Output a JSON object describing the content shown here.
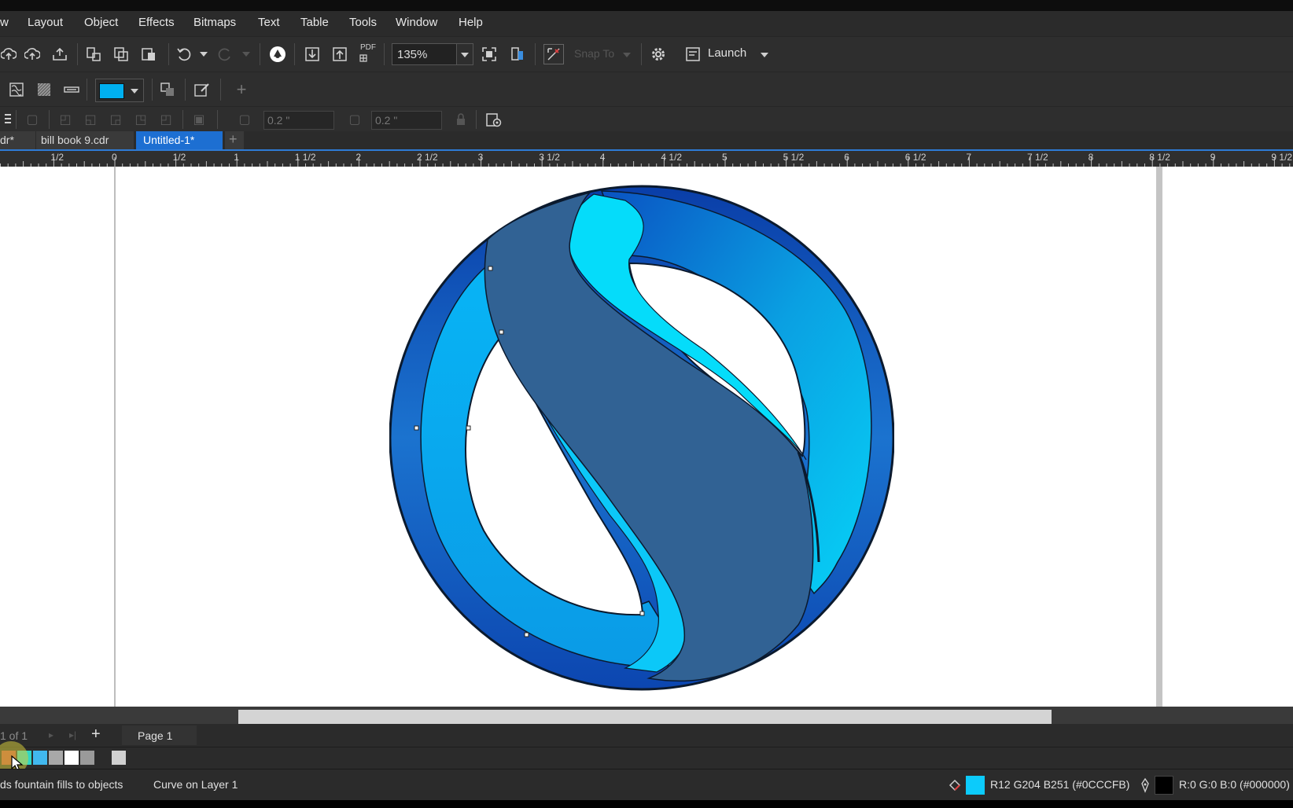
{
  "menu": {
    "items": [
      "w",
      "Layout",
      "Object",
      "Effects",
      "Bitmaps",
      "Text",
      "Table",
      "Tools",
      "Window",
      "Help"
    ]
  },
  "toolbar": {
    "zoom_level": "135%",
    "pdf_label": "PDF",
    "snap_to_label": "Snap To",
    "launch_label": "Launch",
    "fill_color": "#00b0f0"
  },
  "property_bar": {
    "outline_width_1": "0.2 \"",
    "outline_width_2": "0.2 \""
  },
  "document_tabs": {
    "tab1": "dr*",
    "tab2": "bill book 9.cdr",
    "tab3": "Untitled-1*",
    "add": "+"
  },
  "ruler": {
    "labels": [
      "1/2",
      "0",
      "1/2",
      "1",
      "1 1/2",
      "2",
      "2 1/2",
      "3",
      "3 1/2",
      "4",
      "4 1/2",
      "5",
      "5 1/2",
      "6",
      "6 1/2",
      "7",
      "7 1/2",
      "8",
      "8 1/2",
      "9",
      "9 1/2"
    ]
  },
  "page_navigator": {
    "page_count": "1 of 1",
    "add_page": "+",
    "page_tab": "Page 1"
  },
  "palette": {
    "colors": [
      "#c8473f",
      "#2fd7c5",
      "#41b8ee",
      "#a8a8a8",
      "#ffffff",
      "#9a9a9a",
      "#2b2b2b",
      "#d0d0d0"
    ]
  },
  "status": {
    "hint": "ds fountain fills to objects",
    "selection": "Curve on Layer 1",
    "fill_info": "R12 G204 B251 (#0CCCFB)",
    "fill_swatch": "#0ccbfb",
    "outline_info": "R:0 G:0 B:0 (#000000)  0",
    "outline_swatch": "#000000"
  }
}
